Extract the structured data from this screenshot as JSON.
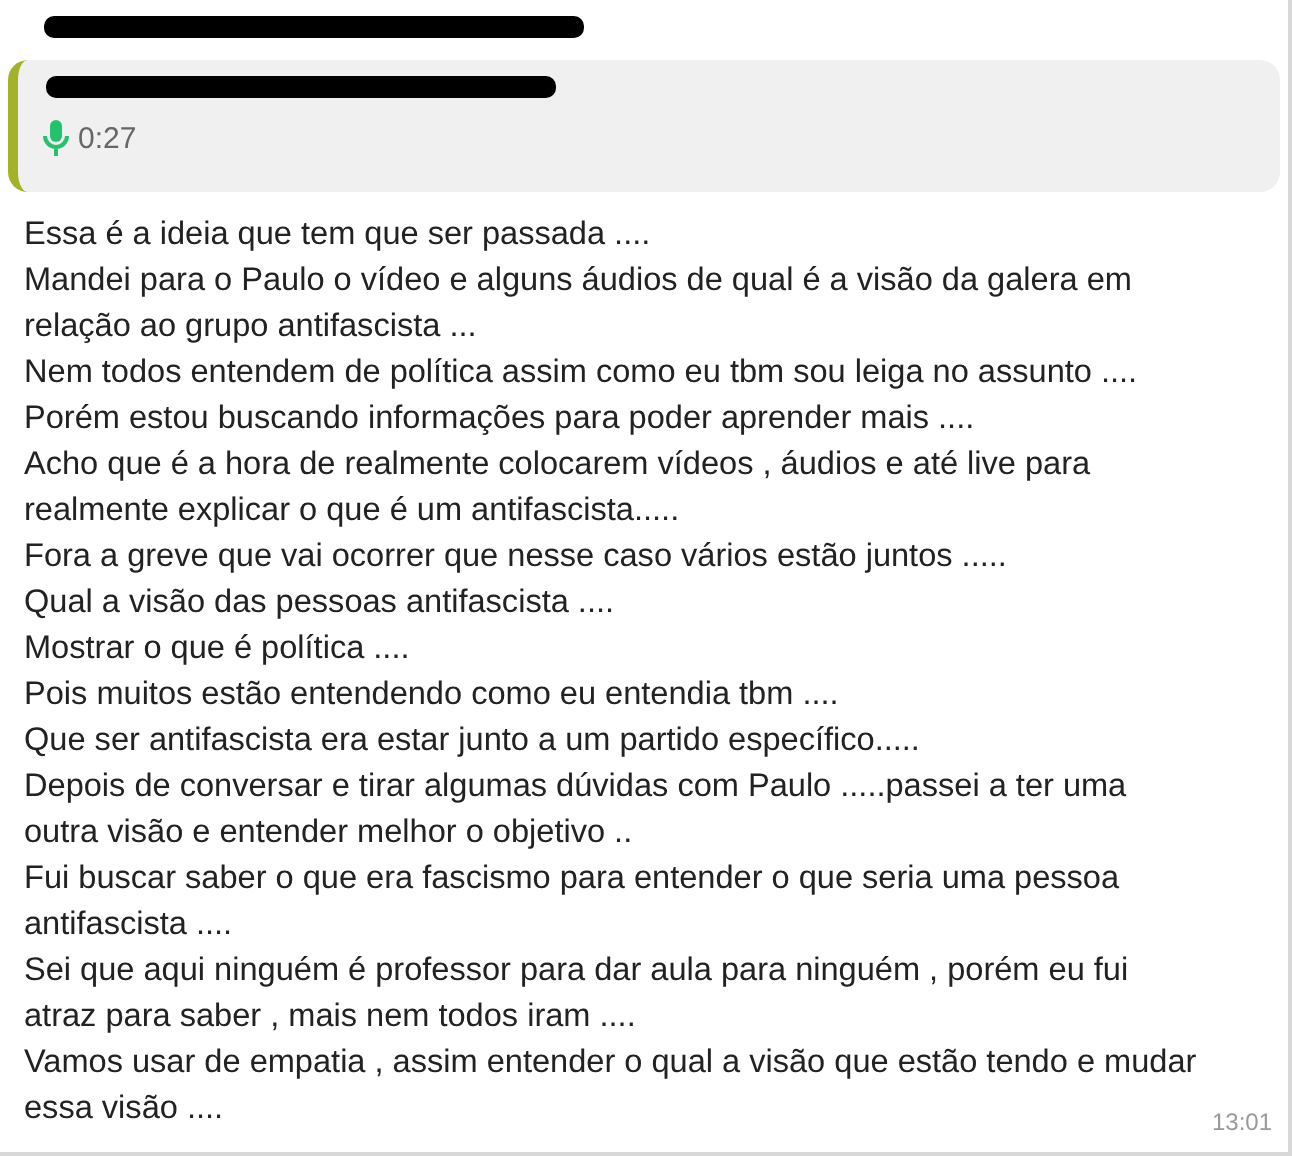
{
  "quoted_message": {
    "duration": "0:27"
  },
  "message": {
    "paragraphs": [
      "Essa é a ideia que tem que ser passada ....",
      "Mandei para o Paulo o vídeo e alguns áudios de qual é a visão da galera em relação ao grupo antifascista ...",
      "Nem todos entendem de política assim como eu tbm sou leiga no assunto ....",
      "Porém estou buscando informações para poder aprender mais ....",
      "Acho que é a hora de realmente colocarem vídeos , áudios e até live para realmente explicar o que é um antifascista.....",
      "Fora a greve que vai ocorrer que nesse caso vários estão juntos .....",
      "Qual a visão das pessoas antifascista ....",
      "Mostrar o que é política ....",
      "Pois muitos estão entendendo como eu entendia tbm ....",
      "Que ser antifascista era estar junto a um partido específico.....",
      "Depois de conversar e tirar algumas dúvidas com Paulo .....passei a ter uma outra visão e entender melhor o objetivo ..",
      "Fui buscar saber o que era fascismo para entender o que seria uma pessoa antifascista ....",
      "Sei que aqui ninguém é professor para dar aula para ninguém , porém eu fui atraz para saber , mais nem todos iram ....",
      "Vamos usar de empatia , assim entender o qual a visão que estão tendo e mudar essa visão ...."
    ],
    "time": "13:01"
  }
}
